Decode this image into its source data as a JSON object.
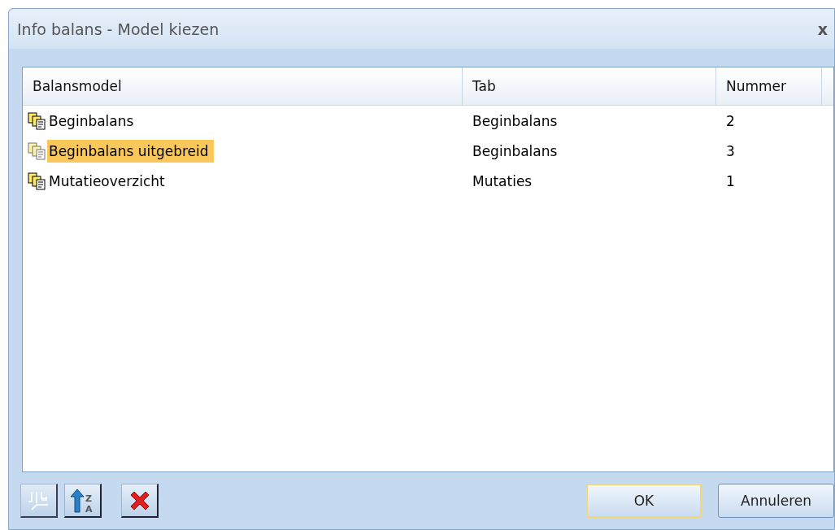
{
  "window": {
    "title": "Info balans - Model kiezen",
    "close": "x"
  },
  "table": {
    "columns": [
      "Balansmodel",
      "Tab",
      "Nummer"
    ],
    "rows": [
      {
        "cells": [
          "Beginbalans",
          "Beginbalans",
          "2"
        ],
        "selected": false
      },
      {
        "cells": [
          "Beginbalans uitgebreid",
          "Beginbalans",
          "3"
        ],
        "selected": true
      },
      {
        "cells": [
          "Mutatieoverzicht",
          "Mutaties",
          "1"
        ],
        "selected": false
      }
    ]
  },
  "toolbar": [
    {
      "kind": "layout",
      "disabled": true
    },
    {
      "kind": "sort",
      "disabled": false,
      "letters": [
        "Z",
        "A"
      ]
    },
    {
      "kind": "delete",
      "disabled": false
    }
  ],
  "buttons": [
    {
      "label": "OK",
      "default": true
    },
    {
      "label": "Annuleren",
      "default": false
    }
  ]
}
